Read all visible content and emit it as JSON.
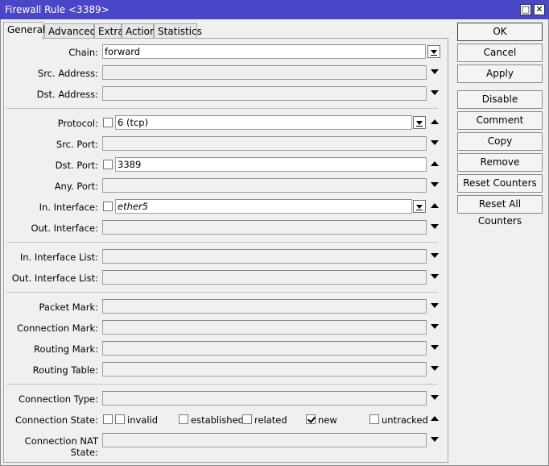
{
  "window": {
    "title": "Firewall Rule <3389>",
    "restore_glyph": "□",
    "close_glyph": "✕"
  },
  "tabs": [
    "General",
    "Advanced",
    "Extra",
    "Action",
    "Statistics"
  ],
  "fields": {
    "chain": {
      "label": "Chain:",
      "value": "forward"
    },
    "src_address": {
      "label": "Src. Address:"
    },
    "dst_address": {
      "label": "Dst. Address:"
    },
    "protocol": {
      "label": "Protocol:",
      "value": "6 (tcp)"
    },
    "src_port": {
      "label": "Src. Port:"
    },
    "dst_port": {
      "label": "Dst. Port:",
      "value": "3389"
    },
    "any_port": {
      "label": "Any. Port:"
    },
    "in_interface": {
      "label": "In. Interface:",
      "value": "ether5"
    },
    "out_interface": {
      "label": "Out. Interface:"
    },
    "in_interface_list": {
      "label": "In. Interface List:"
    },
    "out_interface_list": {
      "label": "Out. Interface List:"
    },
    "packet_mark": {
      "label": "Packet Mark:"
    },
    "connection_mark": {
      "label": "Connection Mark:"
    },
    "routing_mark": {
      "label": "Routing Mark:"
    },
    "routing_table": {
      "label": "Routing Table:"
    },
    "connection_type": {
      "label": "Connection Type:"
    },
    "connection_state": {
      "label": "Connection State:",
      "options": [
        {
          "label": "invalid",
          "checked": false
        },
        {
          "label": "established",
          "checked": false
        },
        {
          "label": "related",
          "checked": false
        },
        {
          "label": "new",
          "checked": true
        },
        {
          "label": "untracked",
          "checked": false
        }
      ]
    },
    "connection_nat_state": {
      "label": "Connection NAT State:"
    }
  },
  "buttons": {
    "ok": "OK",
    "cancel": "Cancel",
    "apply": "Apply",
    "disable": "Disable",
    "comment": "Comment",
    "copy": "Copy",
    "remove": "Remove",
    "reset_counters": "Reset Counters",
    "reset_all_counters": "Reset All Counters"
  }
}
